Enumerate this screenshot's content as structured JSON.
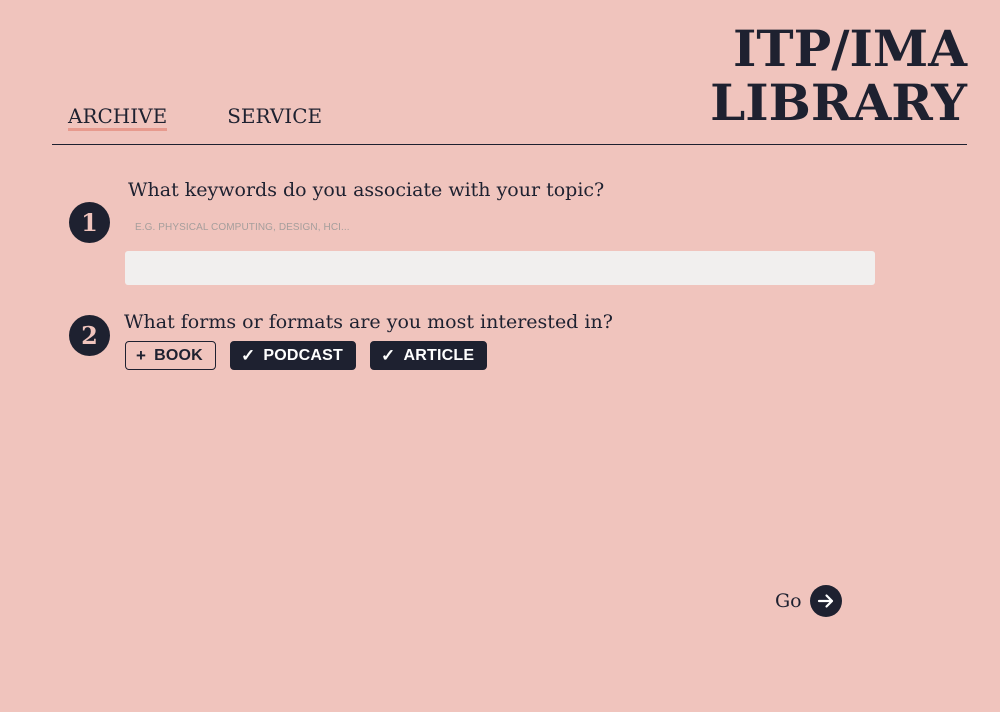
{
  "header": {
    "title_line1": "ITP/IMA",
    "title_line2": "LIBRARY"
  },
  "nav": {
    "items": [
      {
        "label": "ARCHIVE",
        "active": true
      },
      {
        "label": "SERVICE",
        "active": false
      }
    ]
  },
  "step1": {
    "number": "1",
    "question": "What keywords do you associate with your topic?",
    "hint": "E.G. PHYSICAL COMPUTING, DESIGN, HCI...",
    "input_value": ""
  },
  "step2": {
    "number": "2",
    "question": "What forms or formats are you most interested in?",
    "formats": [
      {
        "label": "BOOK",
        "selected": false,
        "mark": "+"
      },
      {
        "label": "PODCAST",
        "selected": true,
        "mark": "✓"
      },
      {
        "label": "ARTICLE",
        "selected": true,
        "mark": "✓"
      }
    ]
  },
  "go": {
    "label": "Go",
    "icon": "arrow-right-icon"
  },
  "colors": {
    "background": "#f0c4bd",
    "ink": "#1e2130",
    "active_underline": "#e79a8e",
    "input_bg": "#f1efee"
  }
}
